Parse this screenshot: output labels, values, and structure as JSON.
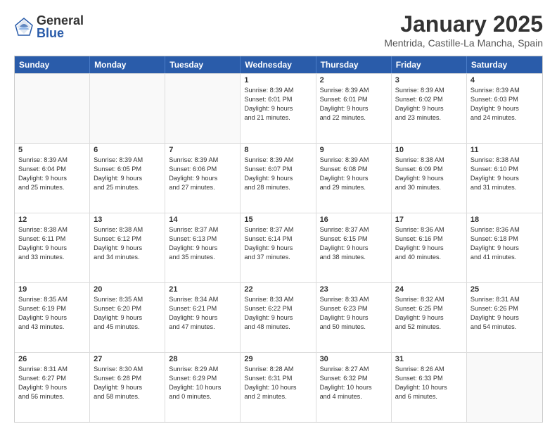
{
  "logo": {
    "general": "General",
    "blue": "Blue"
  },
  "title": "January 2025",
  "location": "Mentrida, Castille-La Mancha, Spain",
  "days_of_week": [
    "Sunday",
    "Monday",
    "Tuesday",
    "Wednesday",
    "Thursday",
    "Friday",
    "Saturday"
  ],
  "weeks": [
    [
      {
        "day": "",
        "lines": []
      },
      {
        "day": "",
        "lines": []
      },
      {
        "day": "",
        "lines": []
      },
      {
        "day": "1",
        "lines": [
          "Sunrise: 8:39 AM",
          "Sunset: 6:01 PM",
          "Daylight: 9 hours",
          "and 21 minutes."
        ]
      },
      {
        "day": "2",
        "lines": [
          "Sunrise: 8:39 AM",
          "Sunset: 6:01 PM",
          "Daylight: 9 hours",
          "and 22 minutes."
        ]
      },
      {
        "day": "3",
        "lines": [
          "Sunrise: 8:39 AM",
          "Sunset: 6:02 PM",
          "Daylight: 9 hours",
          "and 23 minutes."
        ]
      },
      {
        "day": "4",
        "lines": [
          "Sunrise: 8:39 AM",
          "Sunset: 6:03 PM",
          "Daylight: 9 hours",
          "and 24 minutes."
        ]
      }
    ],
    [
      {
        "day": "5",
        "lines": [
          "Sunrise: 8:39 AM",
          "Sunset: 6:04 PM",
          "Daylight: 9 hours",
          "and 25 minutes."
        ]
      },
      {
        "day": "6",
        "lines": [
          "Sunrise: 8:39 AM",
          "Sunset: 6:05 PM",
          "Daylight: 9 hours",
          "and 25 minutes."
        ]
      },
      {
        "day": "7",
        "lines": [
          "Sunrise: 8:39 AM",
          "Sunset: 6:06 PM",
          "Daylight: 9 hours",
          "and 27 minutes."
        ]
      },
      {
        "day": "8",
        "lines": [
          "Sunrise: 8:39 AM",
          "Sunset: 6:07 PM",
          "Daylight: 9 hours",
          "and 28 minutes."
        ]
      },
      {
        "day": "9",
        "lines": [
          "Sunrise: 8:39 AM",
          "Sunset: 6:08 PM",
          "Daylight: 9 hours",
          "and 29 minutes."
        ]
      },
      {
        "day": "10",
        "lines": [
          "Sunrise: 8:38 AM",
          "Sunset: 6:09 PM",
          "Daylight: 9 hours",
          "and 30 minutes."
        ]
      },
      {
        "day": "11",
        "lines": [
          "Sunrise: 8:38 AM",
          "Sunset: 6:10 PM",
          "Daylight: 9 hours",
          "and 31 minutes."
        ]
      }
    ],
    [
      {
        "day": "12",
        "lines": [
          "Sunrise: 8:38 AM",
          "Sunset: 6:11 PM",
          "Daylight: 9 hours",
          "and 33 minutes."
        ]
      },
      {
        "day": "13",
        "lines": [
          "Sunrise: 8:38 AM",
          "Sunset: 6:12 PM",
          "Daylight: 9 hours",
          "and 34 minutes."
        ]
      },
      {
        "day": "14",
        "lines": [
          "Sunrise: 8:37 AM",
          "Sunset: 6:13 PM",
          "Daylight: 9 hours",
          "and 35 minutes."
        ]
      },
      {
        "day": "15",
        "lines": [
          "Sunrise: 8:37 AM",
          "Sunset: 6:14 PM",
          "Daylight: 9 hours",
          "and 37 minutes."
        ]
      },
      {
        "day": "16",
        "lines": [
          "Sunrise: 8:37 AM",
          "Sunset: 6:15 PM",
          "Daylight: 9 hours",
          "and 38 minutes."
        ]
      },
      {
        "day": "17",
        "lines": [
          "Sunrise: 8:36 AM",
          "Sunset: 6:16 PM",
          "Daylight: 9 hours",
          "and 40 minutes."
        ]
      },
      {
        "day": "18",
        "lines": [
          "Sunrise: 8:36 AM",
          "Sunset: 6:18 PM",
          "Daylight: 9 hours",
          "and 41 minutes."
        ]
      }
    ],
    [
      {
        "day": "19",
        "lines": [
          "Sunrise: 8:35 AM",
          "Sunset: 6:19 PM",
          "Daylight: 9 hours",
          "and 43 minutes."
        ]
      },
      {
        "day": "20",
        "lines": [
          "Sunrise: 8:35 AM",
          "Sunset: 6:20 PM",
          "Daylight: 9 hours",
          "and 45 minutes."
        ]
      },
      {
        "day": "21",
        "lines": [
          "Sunrise: 8:34 AM",
          "Sunset: 6:21 PM",
          "Daylight: 9 hours",
          "and 47 minutes."
        ]
      },
      {
        "day": "22",
        "lines": [
          "Sunrise: 8:33 AM",
          "Sunset: 6:22 PM",
          "Daylight: 9 hours",
          "and 48 minutes."
        ]
      },
      {
        "day": "23",
        "lines": [
          "Sunrise: 8:33 AM",
          "Sunset: 6:23 PM",
          "Daylight: 9 hours",
          "and 50 minutes."
        ]
      },
      {
        "day": "24",
        "lines": [
          "Sunrise: 8:32 AM",
          "Sunset: 6:25 PM",
          "Daylight: 9 hours",
          "and 52 minutes."
        ]
      },
      {
        "day": "25",
        "lines": [
          "Sunrise: 8:31 AM",
          "Sunset: 6:26 PM",
          "Daylight: 9 hours",
          "and 54 minutes."
        ]
      }
    ],
    [
      {
        "day": "26",
        "lines": [
          "Sunrise: 8:31 AM",
          "Sunset: 6:27 PM",
          "Daylight: 9 hours",
          "and 56 minutes."
        ]
      },
      {
        "day": "27",
        "lines": [
          "Sunrise: 8:30 AM",
          "Sunset: 6:28 PM",
          "Daylight: 9 hours",
          "and 58 minutes."
        ]
      },
      {
        "day": "28",
        "lines": [
          "Sunrise: 8:29 AM",
          "Sunset: 6:29 PM",
          "Daylight: 10 hours",
          "and 0 minutes."
        ]
      },
      {
        "day": "29",
        "lines": [
          "Sunrise: 8:28 AM",
          "Sunset: 6:31 PM",
          "Daylight: 10 hours",
          "and 2 minutes."
        ]
      },
      {
        "day": "30",
        "lines": [
          "Sunrise: 8:27 AM",
          "Sunset: 6:32 PM",
          "Daylight: 10 hours",
          "and 4 minutes."
        ]
      },
      {
        "day": "31",
        "lines": [
          "Sunrise: 8:26 AM",
          "Sunset: 6:33 PM",
          "Daylight: 10 hours",
          "and 6 minutes."
        ]
      },
      {
        "day": "",
        "lines": []
      }
    ]
  ]
}
